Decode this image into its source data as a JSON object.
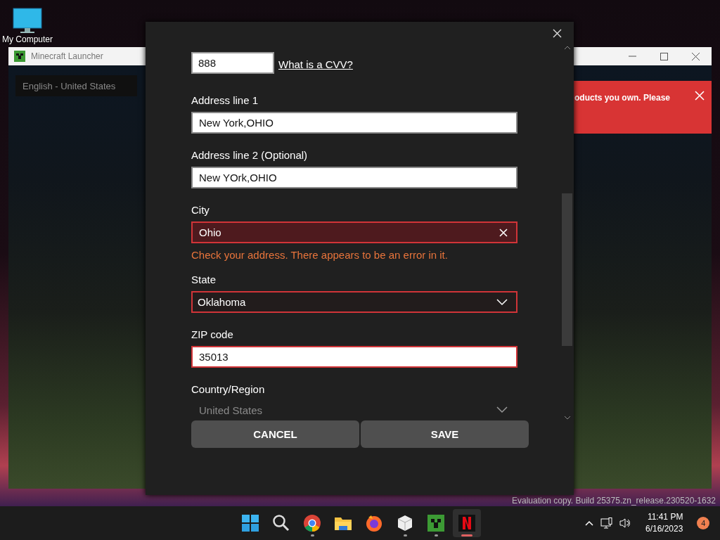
{
  "desktop": {
    "icons": [
      {
        "label": "My Computer"
      }
    ],
    "watermark": "Evaluation copy. Build 25375.zn_release.230520-1632"
  },
  "launcher_window": {
    "title": "Minecraft Launcher",
    "language": "English - United States",
    "banner": {
      "text": "oducts you own. Please"
    }
  },
  "dialog": {
    "cvv": {
      "value": "888",
      "link": "What is a CVV?"
    },
    "fields": [
      {
        "kind": "text",
        "label": "Address line 1",
        "value": "New York,OHIO",
        "error": false,
        "highlighted": false
      },
      {
        "kind": "text",
        "label": "Address line 2 (Optional)",
        "value": "New YOrk,OHIO",
        "error": false,
        "highlighted": false
      },
      {
        "kind": "text",
        "label": "City",
        "value": "Ohio",
        "error": true,
        "highlighted": true,
        "error_message": "Check your address. There appears to be an error in it."
      },
      {
        "kind": "select",
        "label": "State",
        "value": "Oklahoma",
        "error": true,
        "disabled": false
      },
      {
        "kind": "text",
        "label": "ZIP code",
        "value": "35013",
        "error": true,
        "highlighted": false
      },
      {
        "kind": "select",
        "label": "Country/Region",
        "value": "United States",
        "error": false,
        "disabled": true
      }
    ],
    "buttons": [
      "CANCEL",
      "SAVE"
    ]
  },
  "taskbar": {
    "apps": [
      {
        "running": false,
        "active": false
      },
      {
        "running": false,
        "active": false
      },
      {
        "running": true,
        "active": false
      },
      {
        "running": false,
        "active": false
      },
      {
        "running": false,
        "active": false
      },
      {
        "running": true,
        "active": false
      },
      {
        "running": true,
        "active": false
      },
      {
        "running": true,
        "active": true
      }
    ],
    "time": "11:41 PM",
    "date": "6/16/2023",
    "notification_count": "4"
  }
}
